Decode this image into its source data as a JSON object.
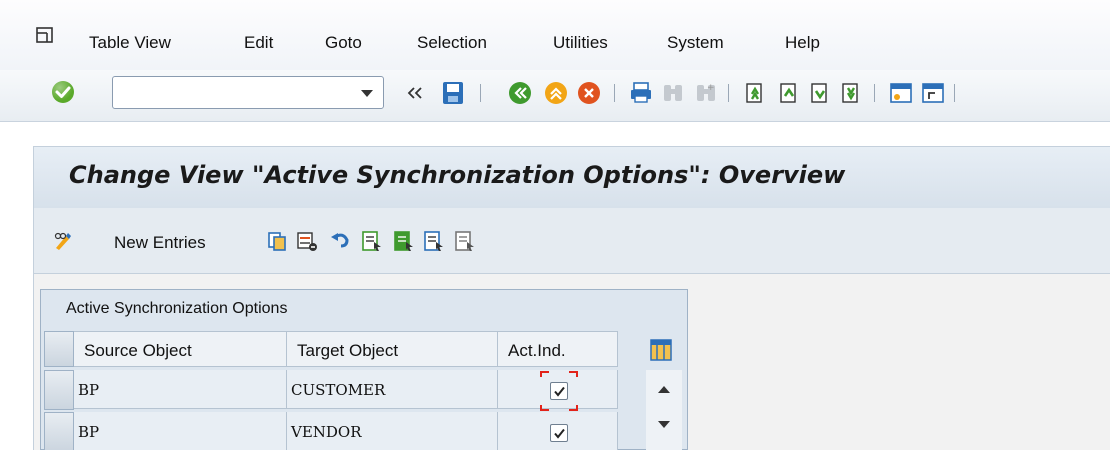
{
  "menu": {
    "items": [
      {
        "label": "Table View"
      },
      {
        "label": "Edit"
      },
      {
        "label": "Goto"
      },
      {
        "label": "Selection"
      },
      {
        "label": "Utilities"
      },
      {
        "label": "System"
      },
      {
        "label": "Help"
      }
    ]
  },
  "toolbar": {
    "command_value": "",
    "icons": [
      "enter-icon",
      "back-icon",
      "save-icon",
      "back-green-icon",
      "exit-icon",
      "cancel-icon",
      "print-icon",
      "find-icon",
      "find-next-icon",
      "first-page-icon",
      "previous-page-icon",
      "next-page-icon",
      "last-page-icon",
      "create-session-icon",
      "shortcut-icon"
    ]
  },
  "screen": {
    "title": "Change View \"Active Synchronization Options\": Overview",
    "new_entries_label": "New Entries"
  },
  "table": {
    "title": "Active Synchronization Options",
    "columns": [
      "Source Object",
      "Target Object",
      "Act.Ind."
    ],
    "rows": [
      {
        "source": "BP",
        "target": "CUSTOMER",
        "active": true
      },
      {
        "source": "BP",
        "target": "VENDOR",
        "active": true
      }
    ]
  },
  "colors": {
    "accent_green": "#4caf50",
    "focus_red": "#e2231a",
    "header_blue": "#dde6ef"
  }
}
